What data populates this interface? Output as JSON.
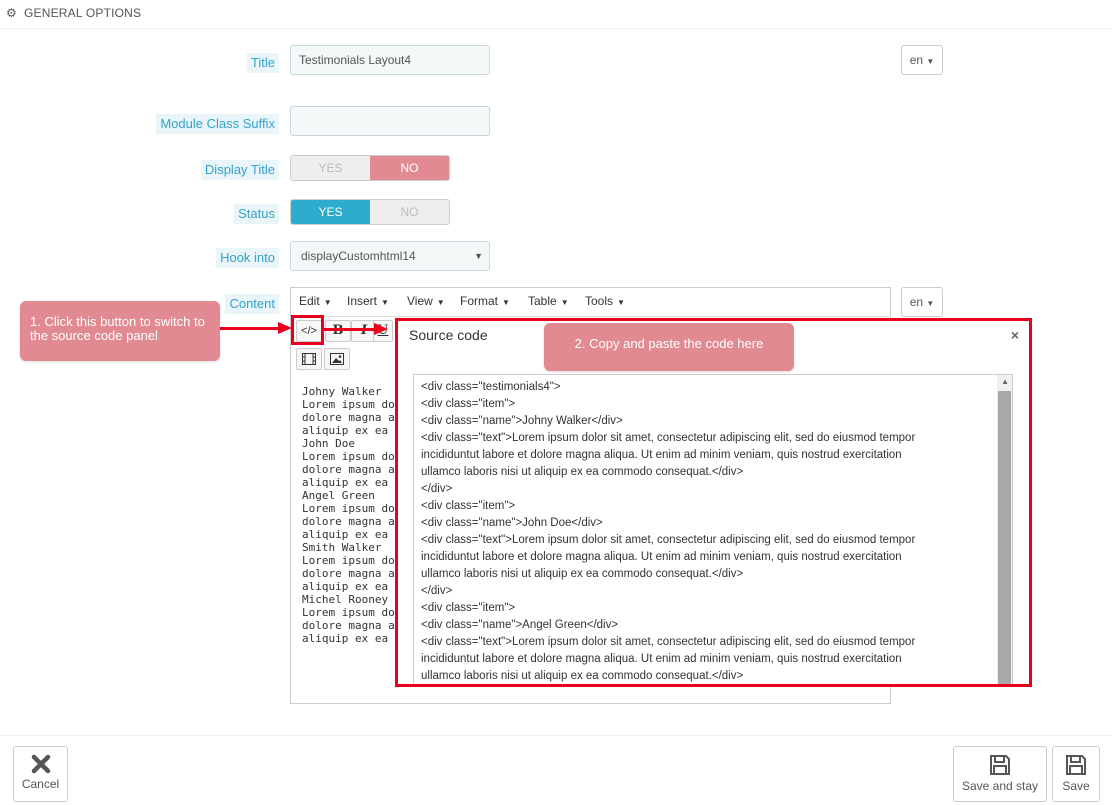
{
  "header": {
    "title": "GENERAL OPTIONS",
    "icon": "gears-icon"
  },
  "form": {
    "title": {
      "label": "Title",
      "value": "Testimonials Layout4",
      "lang": "en"
    },
    "module_class_suffix": {
      "label": "Module Class Suffix",
      "value": ""
    },
    "display_title": {
      "label": "Display Title",
      "yes": "YES",
      "no": "NO",
      "selected": "NO"
    },
    "status": {
      "label": "Status",
      "yes": "YES",
      "no": "NO",
      "selected": "YES"
    },
    "hook_into": {
      "label": "Hook into",
      "value": "displayCustomhtml14"
    },
    "content": {
      "label": "Content",
      "lang": "en"
    }
  },
  "editor": {
    "menu": [
      "Edit",
      "Insert",
      "View",
      "Format",
      "Table",
      "Tools"
    ],
    "toolbar": {
      "source_code": "</>",
      "bold": "B",
      "italic": "I",
      "underline": "U"
    },
    "text_lines": [
      "Johny Walker",
      "Lorem ipsum do",
      "dolore magna al",
      "aliquip ex ea cor",
      "John Doe",
      "Lorem ipsum do",
      "dolore magna al",
      "aliquip ex ea cor",
      "Angel Green",
      "Lorem ipsum do",
      "dolore magna al",
      "aliquip ex ea cor",
      "Smith Walker",
      "Lorem ipsum do",
      "dolore magna al",
      "aliquip ex ea cor",
      "Michel Rooney",
      "Lorem ipsum do",
      "dolore magna al",
      "aliquip ex ea cor"
    ]
  },
  "annotations": {
    "step1": "1. Click this button to switch to the source code panel",
    "step2": "2. Copy and paste the code here",
    "color": "#e8001c",
    "callout_color": "#e18a92"
  },
  "source_modal": {
    "title": "Source code",
    "close": "×",
    "code_lines": [
      "<div class=\"testimonials4\">",
      "<div class=\"item\">",
      "<div class=\"name\">Johny Walker</div>",
      "<div class=\"text\">Lorem ipsum dolor sit amet, consectetur adipiscing elit, sed do eiusmod tempor",
      "incididuntut labore et dolore magna aliqua. Ut enim ad minim veniam, quis nostrud exercitation",
      "ullamco laboris nisi ut aliquip ex ea commodo consequat.</div>",
      "</div>",
      "<div class=\"item\">",
      "<div class=\"name\">John Doe</div>",
      "<div class=\"text\">Lorem ipsum dolor sit amet, consectetur adipiscing elit, sed do eiusmod tempor",
      "incididuntut labore et dolore magna aliqua. Ut enim ad minim veniam, quis nostrud exercitation",
      "ullamco laboris nisi ut aliquip ex ea commodo consequat.</div>",
      "</div>",
      "<div class=\"item\">",
      "<div class=\"name\">Angel Green</div>",
      "<div class=\"text\">Lorem ipsum dolor sit amet, consectetur adipiscing elit, sed do eiusmod tempor",
      "incididuntut labore et dolore magna aliqua. Ut enim ad minim veniam, quis nostrud exercitation",
      "ullamco laboris nisi ut aliquip ex ea commodo consequat.</div>"
    ]
  },
  "footer": {
    "cancel": "Cancel",
    "save_and_stay": "Save and stay",
    "save": "Save"
  },
  "colors": {
    "accent_blue": "#2eacce",
    "no_red": "#e18a92",
    "label_blue": "#33a3c9"
  }
}
